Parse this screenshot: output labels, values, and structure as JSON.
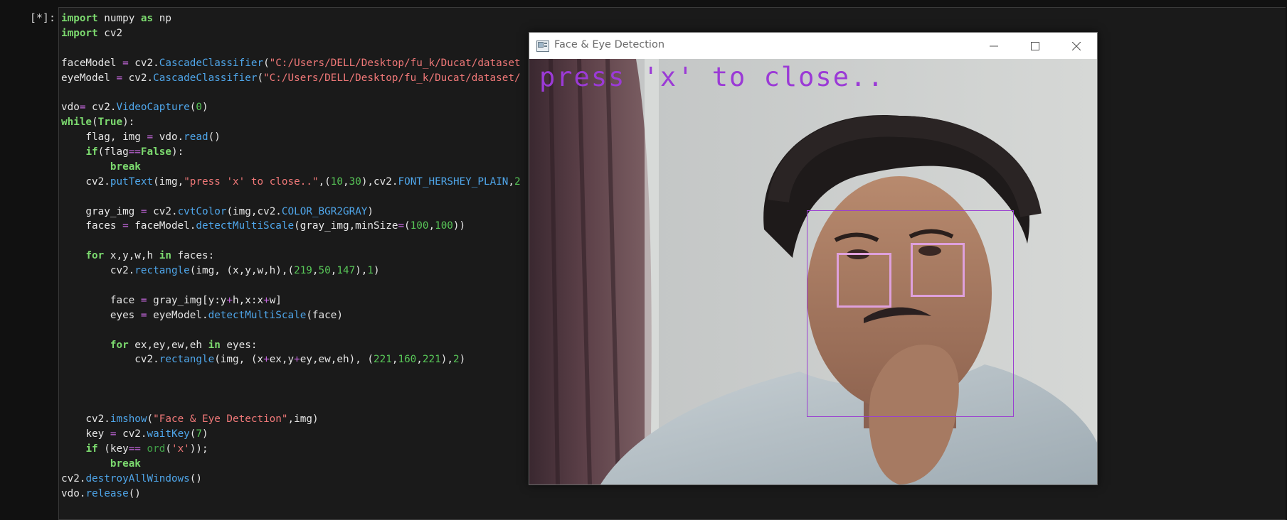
{
  "cell": {
    "prompt": "[*]:",
    "lines": [
      [
        [
          "kw",
          "import"
        ],
        [
          "t",
          " numpy "
        ],
        [
          "kw",
          "as"
        ],
        [
          "t",
          " np"
        ]
      ],
      [
        [
          "kw",
          "import"
        ],
        [
          "t",
          " cv2"
        ]
      ],
      [],
      [
        [
          "t",
          "faceModel "
        ],
        [
          "op",
          "="
        ],
        [
          "t",
          " cv2."
        ],
        [
          "fn",
          "CascadeClassifier"
        ],
        [
          "t",
          "("
        ],
        [
          "str",
          "\"C:/Users/DELL/Desktop/fu_k/Ducat/dataset"
        ]
      ],
      [
        [
          "t",
          "eyeModel "
        ],
        [
          "op",
          "="
        ],
        [
          "t",
          " cv2."
        ],
        [
          "fn",
          "CascadeClassifier"
        ],
        [
          "t",
          "("
        ],
        [
          "str",
          "\"C:/Users/DELL/Desktop/fu_k/Ducat/dataset/"
        ]
      ],
      [],
      [
        [
          "t",
          "vdo"
        ],
        [
          "op",
          "="
        ],
        [
          "t",
          " cv2."
        ],
        [
          "fn",
          "VideoCapture"
        ],
        [
          "t",
          "("
        ],
        [
          "num",
          "0"
        ],
        [
          "t",
          ")"
        ]
      ],
      [
        [
          "kw",
          "while"
        ],
        [
          "t",
          "("
        ],
        [
          "bool",
          "True"
        ],
        [
          "t",
          "):"
        ]
      ],
      [
        [
          "t",
          "    flag, img "
        ],
        [
          "op",
          "="
        ],
        [
          "t",
          " vdo."
        ],
        [
          "fn",
          "read"
        ],
        [
          "t",
          "()"
        ]
      ],
      [
        [
          "t",
          "    "
        ],
        [
          "kw",
          "if"
        ],
        [
          "t",
          "(flag"
        ],
        [
          "op",
          "=="
        ],
        [
          "bool",
          "False"
        ],
        [
          "t",
          "):"
        ]
      ],
      [
        [
          "t",
          "        "
        ],
        [
          "kw",
          "break"
        ]
      ],
      [
        [
          "t",
          "    cv2."
        ],
        [
          "fn",
          "putText"
        ],
        [
          "t",
          "(img,"
        ],
        [
          "str",
          "\"press 'x' to close..\""
        ],
        [
          "t",
          ",("
        ],
        [
          "num",
          "10"
        ],
        [
          "t",
          ","
        ],
        [
          "num",
          "30"
        ],
        [
          "t",
          "),cv2."
        ],
        [
          "fn",
          "FONT_HERSHEY_PLAIN"
        ],
        [
          "t",
          ","
        ],
        [
          "num",
          "2"
        ]
      ],
      [],
      [
        [
          "t",
          "    gray_img "
        ],
        [
          "op",
          "="
        ],
        [
          "t",
          " cv2."
        ],
        [
          "fn",
          "cvtColor"
        ],
        [
          "t",
          "(img,cv2."
        ],
        [
          "fn",
          "COLOR_BGR2GRAY"
        ],
        [
          "t",
          ")"
        ]
      ],
      [
        [
          "t",
          "    faces "
        ],
        [
          "op",
          "="
        ],
        [
          "t",
          " faceModel."
        ],
        [
          "fn",
          "detectMultiScale"
        ],
        [
          "t",
          "(gray_img,minSize"
        ],
        [
          "op",
          "="
        ],
        [
          "t",
          "("
        ],
        [
          "num",
          "100"
        ],
        [
          "t",
          ","
        ],
        [
          "num",
          "100"
        ],
        [
          "t",
          "))"
        ]
      ],
      [],
      [
        [
          "t",
          "    "
        ],
        [
          "kw",
          "for"
        ],
        [
          "t",
          " x,y,w,h "
        ],
        [
          "kw",
          "in"
        ],
        [
          "t",
          " faces:"
        ]
      ],
      [
        [
          "t",
          "        cv2."
        ],
        [
          "fn",
          "rectangle"
        ],
        [
          "t",
          "(img, (x,y,w,h),("
        ],
        [
          "num",
          "219"
        ],
        [
          "t",
          ","
        ],
        [
          "num",
          "50"
        ],
        [
          "t",
          ","
        ],
        [
          "num",
          "147"
        ],
        [
          "t",
          "),"
        ],
        [
          "num",
          "1"
        ],
        [
          "t",
          ")"
        ]
      ],
      [],
      [
        [
          "t",
          "        face "
        ],
        [
          "op",
          "="
        ],
        [
          "t",
          " gray_img[y:y"
        ],
        [
          "op",
          "+"
        ],
        [
          "t",
          "h,x:x"
        ],
        [
          "op",
          "+"
        ],
        [
          "t",
          "w]"
        ]
      ],
      [
        [
          "t",
          "        eyes "
        ],
        [
          "op",
          "="
        ],
        [
          "t",
          " eyeModel."
        ],
        [
          "fn",
          "detectMultiScale"
        ],
        [
          "t",
          "(face)"
        ]
      ],
      [],
      [
        [
          "t",
          "        "
        ],
        [
          "kw",
          "for"
        ],
        [
          "t",
          " ex,ey,ew,eh "
        ],
        [
          "kw",
          "in"
        ],
        [
          "t",
          " eyes:"
        ]
      ],
      [
        [
          "t",
          "            cv2."
        ],
        [
          "fn",
          "rectangle"
        ],
        [
          "t",
          "(img, (x"
        ],
        [
          "op",
          "+"
        ],
        [
          "t",
          "ex,y"
        ],
        [
          "op",
          "+"
        ],
        [
          "t",
          "ey,ew,eh), ("
        ],
        [
          "num",
          "221"
        ],
        [
          "t",
          ","
        ],
        [
          "num",
          "160"
        ],
        [
          "t",
          ","
        ],
        [
          "num",
          "221"
        ],
        [
          "t",
          "),"
        ],
        [
          "num",
          "2"
        ],
        [
          "t",
          ")"
        ]
      ],
      [],
      [],
      [],
      [
        [
          "t",
          "    cv2."
        ],
        [
          "fn",
          "imshow"
        ],
        [
          "t",
          "("
        ],
        [
          "str",
          "\"Face & Eye Detection\""
        ],
        [
          "t",
          ",img)"
        ]
      ],
      [
        [
          "t",
          "    key "
        ],
        [
          "op",
          "="
        ],
        [
          "t",
          " cv2."
        ],
        [
          "fn",
          "waitKey"
        ],
        [
          "t",
          "("
        ],
        [
          "num",
          "7"
        ],
        [
          "t",
          ")"
        ]
      ],
      [
        [
          "t",
          "    "
        ],
        [
          "kw",
          "if"
        ],
        [
          "t",
          " (key"
        ],
        [
          "op",
          "=="
        ],
        [
          "t",
          " "
        ],
        [
          "blt",
          "ord"
        ],
        [
          "t",
          "("
        ],
        [
          "str",
          "'x'"
        ],
        [
          "t",
          "));"
        ]
      ],
      [
        [
          "t",
          "        "
        ],
        [
          "kw",
          "break"
        ]
      ],
      [
        [
          "t",
          "cv2."
        ],
        [
          "fn",
          "destroyAllWindows"
        ],
        [
          "t",
          "()"
        ]
      ],
      [
        [
          "t",
          "vdo."
        ],
        [
          "fn",
          "release"
        ],
        [
          "t",
          "()"
        ]
      ]
    ]
  },
  "window": {
    "title": "Face & Eye Detection",
    "app_icon": "opencv-window-icon",
    "buttons": {
      "minimize": "minimize-icon",
      "maximize": "maximize-icon",
      "close": "close-icon"
    },
    "overlay_text": "press 'x' to close..",
    "overlay_color": "#9b3ad6",
    "face_box_color": "#9a3fd1",
    "eye_box_color": "#dea0dc"
  }
}
